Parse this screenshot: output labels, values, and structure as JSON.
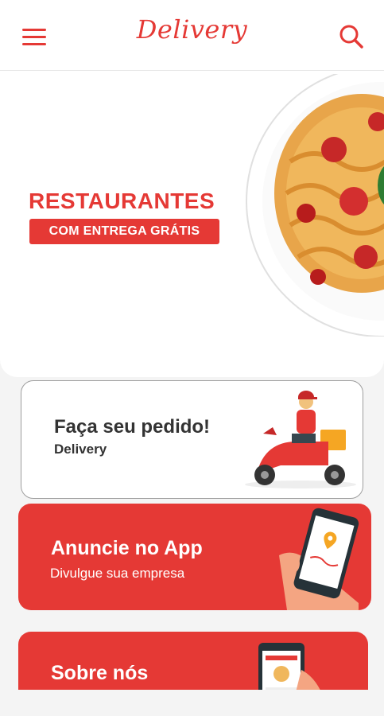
{
  "header": {
    "logo_text": "Delivery",
    "menu_icon": "hamburger-menu-icon",
    "search_icon": "search-icon"
  },
  "hero": {
    "title": "RESTAURANTES",
    "badge": "COM ENTREGA GRÁTIS",
    "image": "pasta-dish-image"
  },
  "cards": {
    "order": {
      "title": "Faça seu pedido!",
      "subtitle": "Delivery",
      "image": "delivery-scooter-illustration"
    },
    "advertise": {
      "title": "Anuncie no App",
      "subtitle": "Divulgue sua empresa",
      "image": "phone-in-hand-illustration"
    },
    "about": {
      "title": "Sobre nós",
      "image": "phone-app-illustration"
    }
  },
  "colors": {
    "accent": "#e53935",
    "background": "#f4f4f4"
  }
}
